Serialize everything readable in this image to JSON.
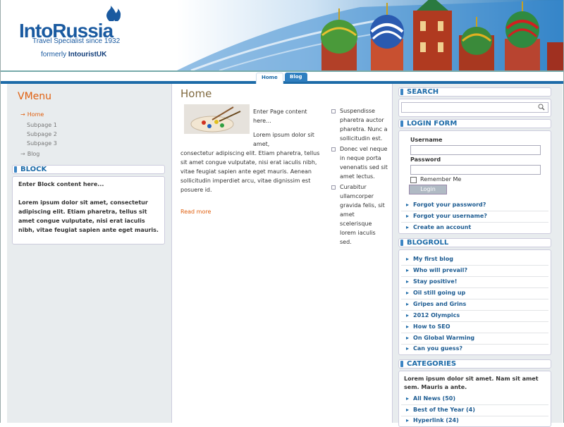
{
  "header": {
    "logo_main": "IntoRussia",
    "logo_tagline": "Travel Specialist since 1932",
    "logo_former_prefix": "formerly ",
    "logo_former_brand": "IntouristUK"
  },
  "nav": {
    "tabs": [
      {
        "label": "Home"
      },
      {
        "label": "Blog"
      }
    ]
  },
  "left": {
    "vmenu_title": "VMenu",
    "vmenu_items": [
      {
        "label": "Home"
      },
      {
        "label": "Subpage 1"
      },
      {
        "label": "Subpage 2"
      },
      {
        "label": "Subpage 3"
      },
      {
        "label": "Blog"
      }
    ],
    "block_title": "BLOCK",
    "block_intro": "Enter Block content here...",
    "block_text": "Lorem ipsum dolor sit amet, consectetur adipiscing elit. Etiam pharetra, tellus sit amet congue vulputate, nisi erat iaculis nibh, vitae feugiat sapien ante eget mauris."
  },
  "main": {
    "title": "Home",
    "para1": "Enter Page content here...",
    "para2_a": "Lorem ipsum dolor sit amet,",
    "para2_b": "consectetur adipiscing elit. Etiam pharetra, tellus sit amet congue vulputate, nisi erat iaculis nibh, vitae feugiat sapien ante eget mauris. Aenean sollicitudin imperdiet arcu, vitae dignissim est posuere id.",
    "read_more": "Read more",
    "bullets": [
      "Suspendisse pharetra auctor pharetra. Nunc a sollicitudin est.",
      "Donec vel neque in neque porta venenatis sed sit amet lectus.",
      "Curabitur ullamcorper gravida felis, sit amet scelerisque lorem iaculis sed."
    ]
  },
  "right": {
    "search_title": "SEARCH",
    "login_title": "LOGIN FORM",
    "username_label": "Username",
    "password_label": "Password",
    "remember_label": "Remember Me",
    "login_button": "Login",
    "login_links": [
      "Forgot your password?",
      "Forgot your username?",
      "Create an account"
    ],
    "blogroll_title": "BLOGROLL",
    "blogroll": [
      "My first blog",
      "Who will prevail?",
      "Stay positive!",
      "Oil still going up",
      "Gripes and Grins",
      "2012 Olympics",
      "How to SEO",
      "On Global Warming",
      "Can you guess?"
    ],
    "categories_title": "CATEGORIES",
    "categories_text": "Lorem ipsum dolor sit amet. Nam sit amet sem. Mauris a ante.",
    "categories": [
      "All News (50)",
      "Best of the Year (4)",
      "Hyperlink (24)"
    ]
  },
  "colors": {
    "accent": "#1d6ba8",
    "highlight": "#e06010",
    "title": "#806a40"
  }
}
